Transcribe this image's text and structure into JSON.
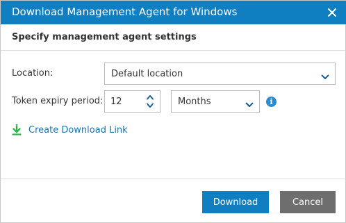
{
  "dialog": {
    "title": "Download Management Agent for Windows",
    "subtitle": "Specify management agent settings"
  },
  "form": {
    "location": {
      "label": "Location:",
      "value": "Default location"
    },
    "token_expiry": {
      "label": "Token expiry period:",
      "amount": "12",
      "unit": "Months"
    }
  },
  "link": {
    "label": "Create Download Link"
  },
  "buttons": {
    "download": "Download",
    "cancel": "Cancel"
  },
  "colors": {
    "accent": "#0f7fc1",
    "link": "#1a73a8",
    "download_icon": "#2fb34a",
    "cancel_button": "#6e6e6e"
  },
  "icons": [
    "close-icon",
    "chevron-down-icon",
    "chevron-up-icon",
    "info-icon",
    "download-icon"
  ]
}
